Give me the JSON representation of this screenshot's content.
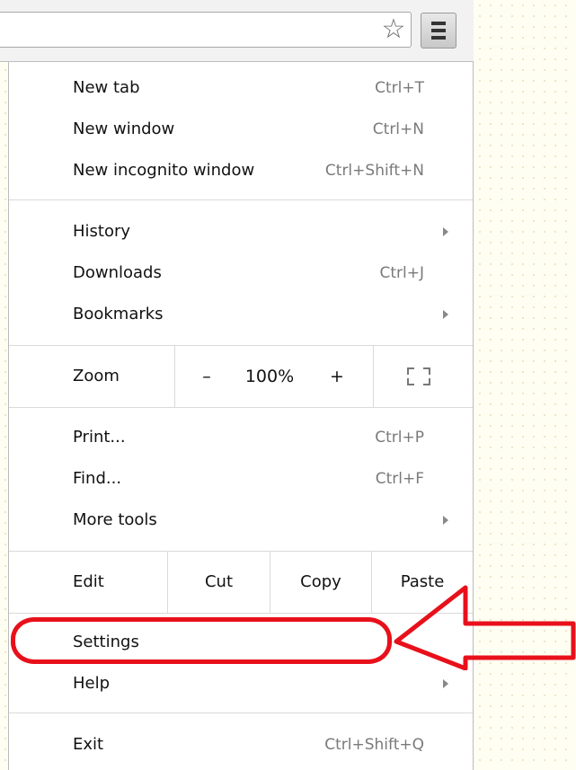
{
  "toolbar": {
    "star_icon": "star-outline-icon",
    "menu_icon": "hamburger-menu-icon"
  },
  "menu": {
    "group1": [
      {
        "label": "New tab",
        "shortcut": "Ctrl+T"
      },
      {
        "label": "New window",
        "shortcut": "Ctrl+N"
      },
      {
        "label": "New incognito window",
        "shortcut": "Ctrl+Shift+N"
      }
    ],
    "group2": [
      {
        "label": "History",
        "submenu": true
      },
      {
        "label": "Downloads",
        "shortcut": "Ctrl+J"
      },
      {
        "label": "Bookmarks",
        "submenu": true
      }
    ],
    "zoom": {
      "label": "Zoom",
      "minus": "–",
      "value": "100%",
      "plus": "+",
      "fullscreen_icon": "fullscreen-icon"
    },
    "group3": [
      {
        "label": "Print...",
        "shortcut": "Ctrl+P"
      },
      {
        "label": "Find...",
        "shortcut": "Ctrl+F"
      },
      {
        "label": "More tools",
        "submenu": true
      }
    ],
    "edit": {
      "label": "Edit",
      "cut": "Cut",
      "copy": "Copy",
      "paste": "Paste"
    },
    "group4": [
      {
        "label": "Settings"
      },
      {
        "label": "Help",
        "submenu": true
      }
    ],
    "group5": [
      {
        "label": "Exit",
        "shortcut": "Ctrl+Shift+Q"
      }
    ]
  },
  "annotation": {
    "color": "#e8101a",
    "target": "Settings"
  }
}
